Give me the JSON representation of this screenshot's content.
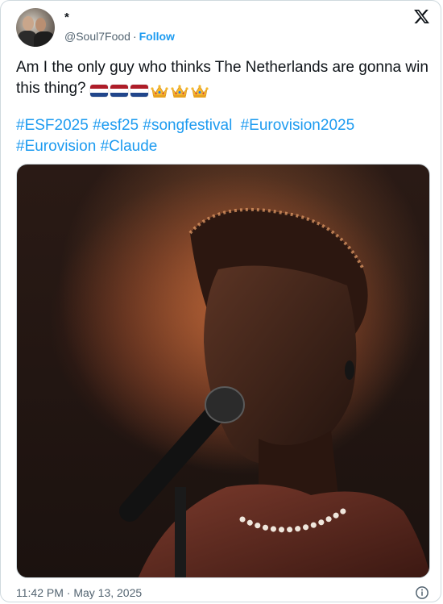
{
  "tweet": {
    "author_name": "*",
    "handle": "@Soul7Food",
    "separator": "·",
    "follow_label": "Follow",
    "text": "Am I the only guy who thinks The Netherlands are gonna win this thing?",
    "emoji": [
      "netherlands-flag",
      "netherlands-flag",
      "netherlands-flag",
      "crown",
      "crown",
      "crown"
    ],
    "hashtags_line1": [
      "#ESF2025",
      "#esf25",
      "#songfestival",
      "#Eurovision2025"
    ],
    "hashtags_line2": [
      "#Eurovision",
      "#Claude"
    ],
    "timestamp": "11:42 PM · May 13, 2025"
  },
  "icons": {
    "logo": "x-logo",
    "info": "info-icon"
  },
  "colors": {
    "link": "#1d9bf0",
    "secondary_text": "#536471",
    "primary_text": "#0f1419",
    "border": "#cfd9de"
  }
}
